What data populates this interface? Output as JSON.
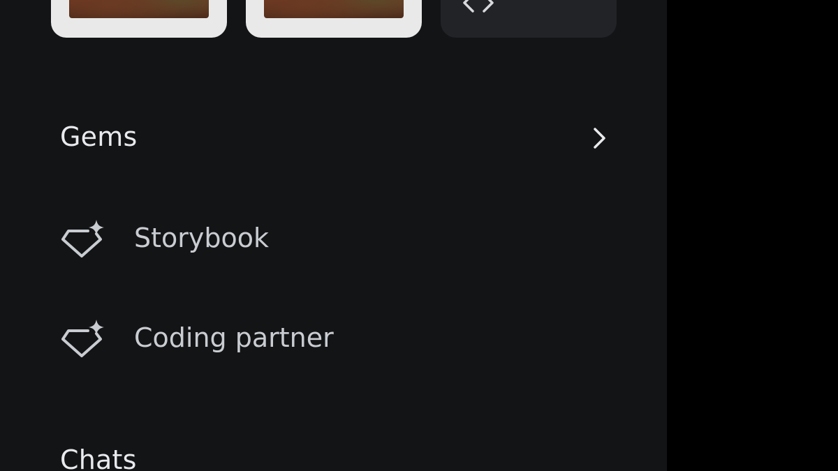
{
  "gems": {
    "header": "Gems",
    "items": [
      {
        "label": "Storybook",
        "icon": "gem-sparkle-icon"
      },
      {
        "label": "Coding partner",
        "icon": "gem-sparkle-icon"
      }
    ]
  },
  "chats": {
    "header": "Chats"
  },
  "icons": {
    "chevron": "chevron-right-icon",
    "code": "code-icon"
  },
  "colors": {
    "drawer_bg": "#131416",
    "outer_bg": "#000000",
    "text_primary": "#e8eaed",
    "text_secondary": "#c9ccd1",
    "tile_bg": "#212327",
    "thumb_frame": "#e9e9e9"
  }
}
